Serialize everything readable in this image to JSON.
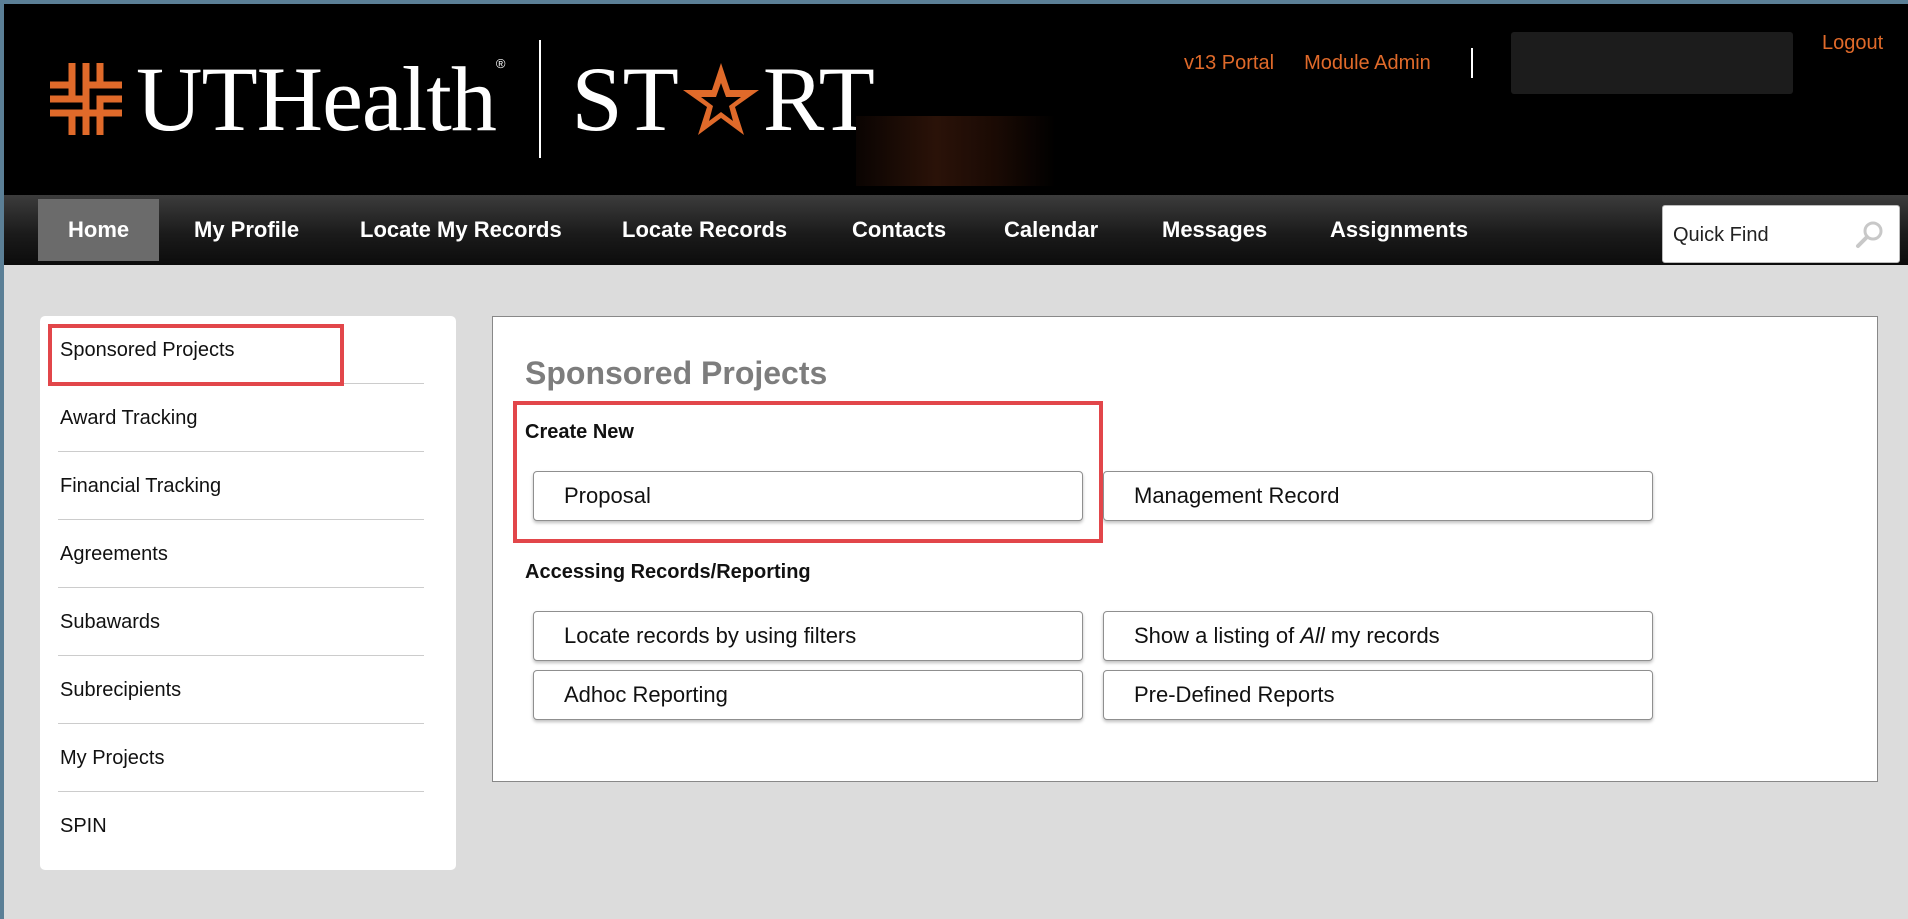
{
  "header": {
    "logo_ut": "UTHealth",
    "logo_registered": "®",
    "logo_start_left": "ST",
    "logo_start_right": "RT",
    "links": [
      "v13 Portal",
      "Module Admin"
    ],
    "logout": "Logout",
    "brand_color": "#e06a2a"
  },
  "nav": {
    "items": [
      "Home",
      "My Profile",
      "Locate My Records",
      "Locate Records",
      "Contacts",
      "Calendar",
      "Messages",
      "Assignments"
    ],
    "active": "Home",
    "quick_find_value": "Quick Find"
  },
  "sidebar": {
    "items": [
      "Sponsored Projects",
      "Award Tracking",
      "Financial Tracking",
      "Agreements",
      "Subawards",
      "Subrecipients",
      "My Projects",
      "SPIN"
    ],
    "highlighted": "Sponsored Projects",
    "highlight_color": "#e2464a"
  },
  "main": {
    "title": "Sponsored Projects",
    "create_new": {
      "label": "Create New",
      "buttons": [
        "Proposal",
        "Management Record"
      ]
    },
    "accessing": {
      "label": "Accessing Records/Reporting",
      "buttons": [
        "Locate records by using filters",
        "Show a listing of ",
        "All",
        " my records",
        "Adhoc Reporting",
        "Pre-Defined Reports"
      ]
    }
  }
}
